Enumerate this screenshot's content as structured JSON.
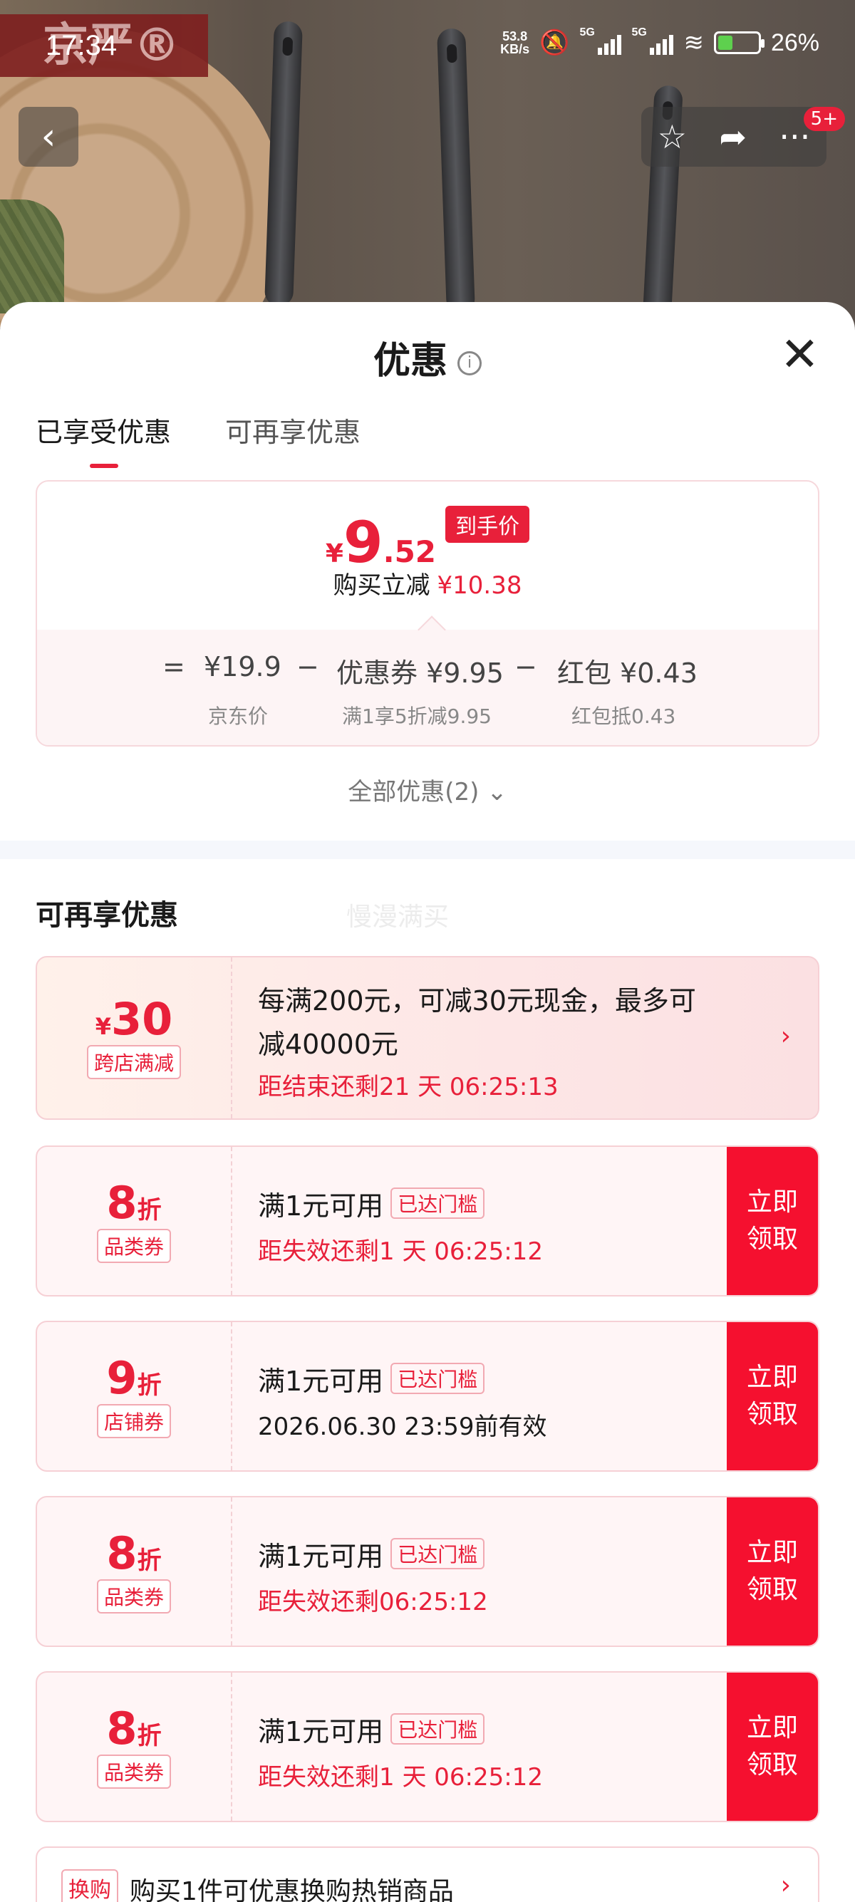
{
  "status_bar": {
    "time": "17:34",
    "net_speed": "53.8",
    "net_unit": "KB/s",
    "sig1": "5G",
    "sig2": "5G",
    "battery": "26%"
  },
  "backdrop": {
    "logo_text": "京严®"
  },
  "nav": {
    "back_icon": "‹",
    "star_icon": "☆",
    "share_icon": "➦",
    "more_icon": "···",
    "badge": "5+"
  },
  "sheet": {
    "title": "优惠",
    "info_icon": "i",
    "close_icon": "✕",
    "tabs": [
      {
        "label": "已享受优惠"
      },
      {
        "label": "可再享优惠"
      }
    ]
  },
  "summary": {
    "yen": "¥",
    "price_int": "9",
    "price_dec": ".52",
    "price_tag": "到手价",
    "reduce_label": "购买立减",
    "reduce_value": "¥10.38",
    "eq1": "=",
    "jd_price": "¥19.9",
    "jd_label": "京东价",
    "minus1": "−",
    "coupon": "优惠券 ¥9.95",
    "coupon_label": "满1享5折减9.95",
    "minus2": "−",
    "redpack": "红包 ¥0.43",
    "redpack_label": "红包抵0.43"
  },
  "all_discounts": "全部优惠(2) ⌄",
  "more_section": {
    "title": "可再享优惠",
    "watermark": "慢漫满买"
  },
  "cards": [
    {
      "amt_prefix": "¥",
      "amt": "30",
      "tag": "跨店满减",
      "line1": "每满200元，可减30元现金，最多可",
      "line1b": "减40000元",
      "line2": "距结束还剩21 天 06:25:13",
      "chev": "›"
    },
    {
      "amt": "8",
      "suffix": "折",
      "tag": "品类券",
      "line1": "满1元可用",
      "reach": "已达门槛",
      "line2": "距失效还剩1 天 06:25:12",
      "get1": "立即",
      "get2": "领取"
    },
    {
      "amt": "9",
      "suffix": "折",
      "tag": "店铺券",
      "line1": "满1元可用",
      "reach": "已达门槛",
      "line2": "2026.06.30 23:59前有效",
      "get1": "立即",
      "get2": "领取"
    },
    {
      "amt": "8",
      "suffix": "折",
      "tag": "品类券",
      "line1": "满1元可用",
      "reach": "已达门槛",
      "line2": "距失效还剩06:25:12",
      "get1": "立即",
      "get2": "领取"
    },
    {
      "amt": "8",
      "suffix": "折",
      "tag": "品类券",
      "line1": "满1元可用",
      "reach": "已达门槛",
      "line2": "距失效还剩1 天 06:25:12",
      "get1": "立即",
      "get2": "领取"
    }
  ],
  "swap": {
    "tag": "换购",
    "text": "购买1件可优惠换购热销商品",
    "chev": "›"
  },
  "colors": {
    "accent": "#e8203a",
    "button": "#f5102f"
  }
}
